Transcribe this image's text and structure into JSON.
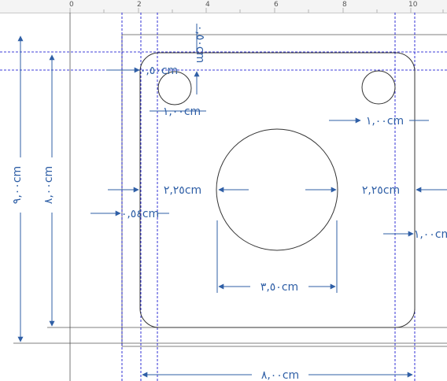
{
  "colors": {
    "part": "#333333",
    "frame": "#555555",
    "guide": "#0000cc",
    "dimension": "#2f5fa6",
    "dimension_text": "#2f5fa6",
    "ruler_bg": "#f4f4f4",
    "ruler_text": "#555555"
  },
  "ruler": {
    "labels": [
      "0",
      "2",
      "4",
      "6",
      "8",
      "10"
    ]
  },
  "dimensions": {
    "overall_height_outer": "٩,٠٠cm",
    "overall_height_inner": "٨,٠٠cm",
    "top_offset_vertical": "٠,٥٠cm",
    "top_offset_horizontal": "٠,٥٠cm",
    "hole_left_diameter": "١,٠٠cm",
    "hole_right_diameter": "١,٠٠cm",
    "left_gap": "٢,٢٥cm",
    "right_gap": "٢,٢٥cm",
    "left_small_offset": "٠,٥٤cm",
    "right_offset": "١,٠٠cm",
    "center_circle_diameter": "٣,٥٠cm",
    "overall_width": "٨,٠٠cm"
  }
}
